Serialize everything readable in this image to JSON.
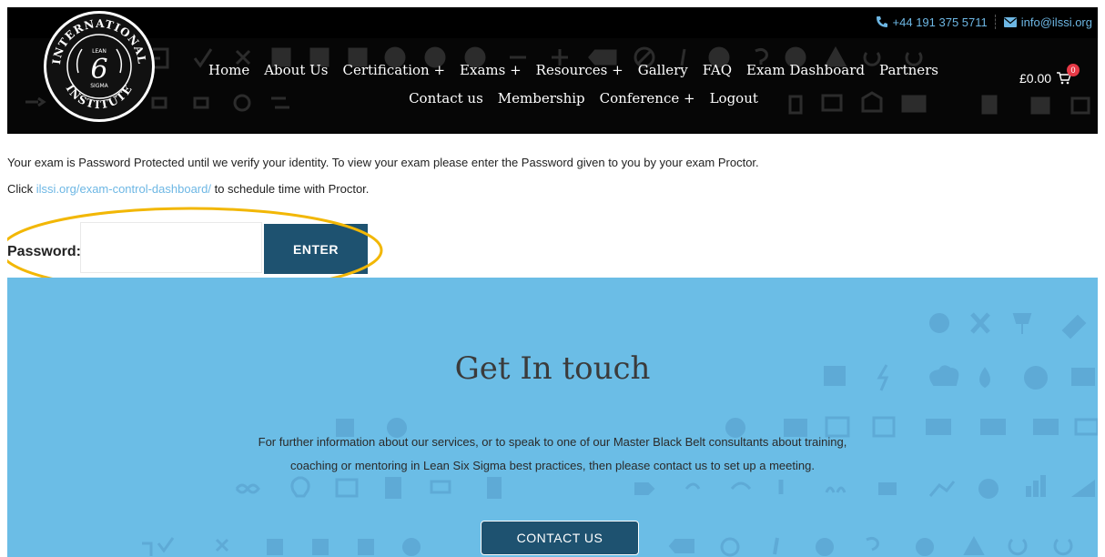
{
  "topbar": {
    "phone": "+44 191 375 5711",
    "email": "info@ilssi.org",
    "phone_icon": "phone-icon",
    "email_icon": "envelope-icon"
  },
  "logo": {
    "top_text": "INTERNATIONAL",
    "center_small": "LEAN",
    "center_mark": "6",
    "center_bottom": "SIGMA",
    "bottom_text": "INSTITUTE"
  },
  "nav": {
    "row1": [
      {
        "id": "home",
        "label": "Home"
      },
      {
        "id": "about",
        "label": "About Us"
      },
      {
        "id": "certification",
        "label": "Certification  +"
      },
      {
        "id": "exams",
        "label": "Exams  +"
      },
      {
        "id": "resources",
        "label": "Resources  +"
      },
      {
        "id": "gallery",
        "label": "Gallery"
      },
      {
        "id": "faq",
        "label": "FAQ"
      },
      {
        "id": "exam-dashboard",
        "label": "Exam Dashboard"
      },
      {
        "id": "partners",
        "label": "Partners"
      }
    ],
    "row2": [
      {
        "id": "contact",
        "label": "Contact us"
      },
      {
        "id": "membership",
        "label": "Membership"
      },
      {
        "id": "conference",
        "label": "Conference  +"
      },
      {
        "id": "logout",
        "label": "Logout"
      }
    ]
  },
  "cart": {
    "amount": "£0.00",
    "count": "0",
    "icon": "cart-icon"
  },
  "content": {
    "notice": "Your exam is Password Protected until we verify your identity. To view your exam please enter the Password given to you by your exam Proctor.",
    "click_prefix": "Click ",
    "link_text": "ilssi.org/exam-control-dashboard/",
    "click_suffix": " to schedule time with Proctor.",
    "password_label": "Password:",
    "password_value": "",
    "enter_label": "ENTER",
    "highlight_color": "#f2b705"
  },
  "contact_section": {
    "title": "Get In touch",
    "body_line1": "For further information about our services, or to speak to one of our Master Black Belt consultants about training,",
    "body_line2": "coaching or mentoring in Lean Six Sigma best practices, then please contact us to set up a meeting.",
    "button_label": "CONTACT US",
    "bg_color": "#6bbde6"
  },
  "colors": {
    "header_bg": "#060606",
    "accent": "#6db7e4",
    "button": "#1e5270"
  }
}
